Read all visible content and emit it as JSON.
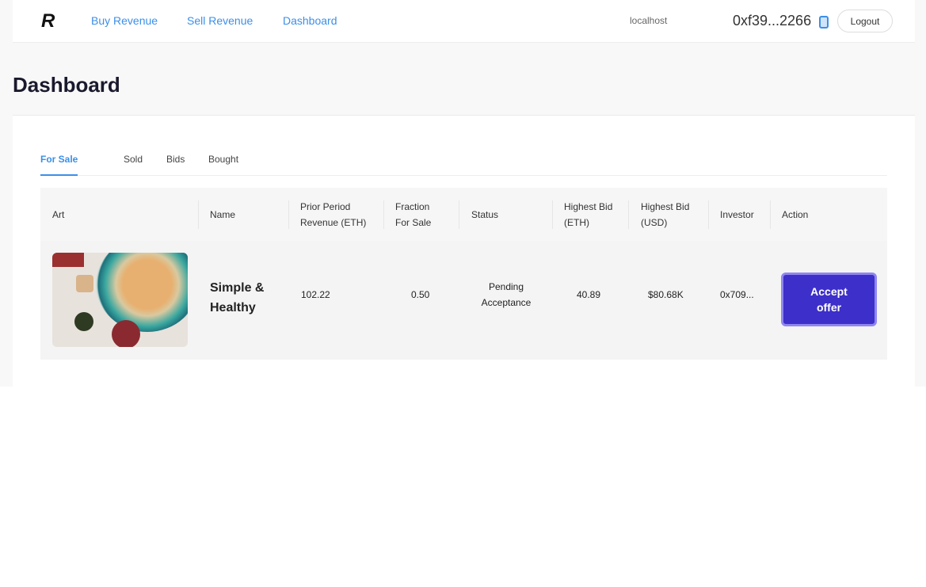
{
  "nav": {
    "logo": "R",
    "links": [
      "Buy Revenue",
      "Sell Revenue",
      "Dashboard"
    ],
    "host": "localhost",
    "address": "0xf39...2266",
    "logout": "Logout"
  },
  "page": {
    "title": "Dashboard"
  },
  "tabs": [
    "For Sale",
    "Sold",
    "Bids",
    "Bought"
  ],
  "columns": [
    "Art",
    "Name",
    "Prior Period Revenue (ETH)",
    "Fraction For Sale",
    "Status",
    "Highest Bid (ETH)",
    "Highest Bid (USD)",
    "Investor",
    "Action"
  ],
  "row": {
    "name": "Simple & Healthy",
    "revenue": "102.22",
    "fraction": "0.50",
    "status": "Pending Acceptance",
    "bid_eth": "40.89",
    "bid_usd": "$80.68K",
    "investor": "0x709...",
    "action": "Accept offer"
  },
  "colors": {
    "accent": "#3b8fe8",
    "button": "#3d2fc9"
  }
}
